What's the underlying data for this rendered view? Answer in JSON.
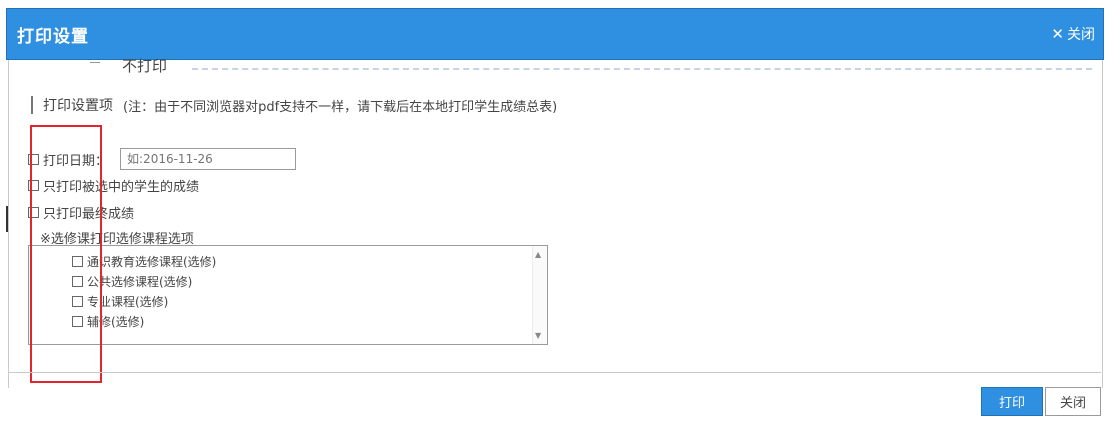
{
  "dialog": {
    "title": "打印设置",
    "close_label": "关闭",
    "close_glyph": "✕"
  },
  "settings": {
    "header": "打印设置项",
    "note": "(注：由于不同浏览器对pdf支持不一样，请下载后在本地打印学生成绩总表)",
    "sheet_label": "不打印"
  },
  "options": [
    {
      "label": "打印日期："
    },
    {
      "label": "只打印被选中的学生的成绩"
    },
    {
      "label": "只打印最终成绩"
    }
  ],
  "date_input": {
    "placeholder": "如:2016-11-26"
  },
  "course_list": {
    "label": "※选修课打印选修课程选项",
    "items": [
      {
        "label": "通识教育选修课程(选修)"
      },
      {
        "label": "公共选修课程(选修)"
      },
      {
        "label": "专业课程(选修)"
      },
      {
        "label": "辅修(选修)"
      }
    ]
  },
  "footer": {
    "confirm_label": "打印",
    "close_label": "关闭"
  },
  "colors": {
    "titlebar": "#2f8fe0",
    "highlight": "#e0272f"
  }
}
